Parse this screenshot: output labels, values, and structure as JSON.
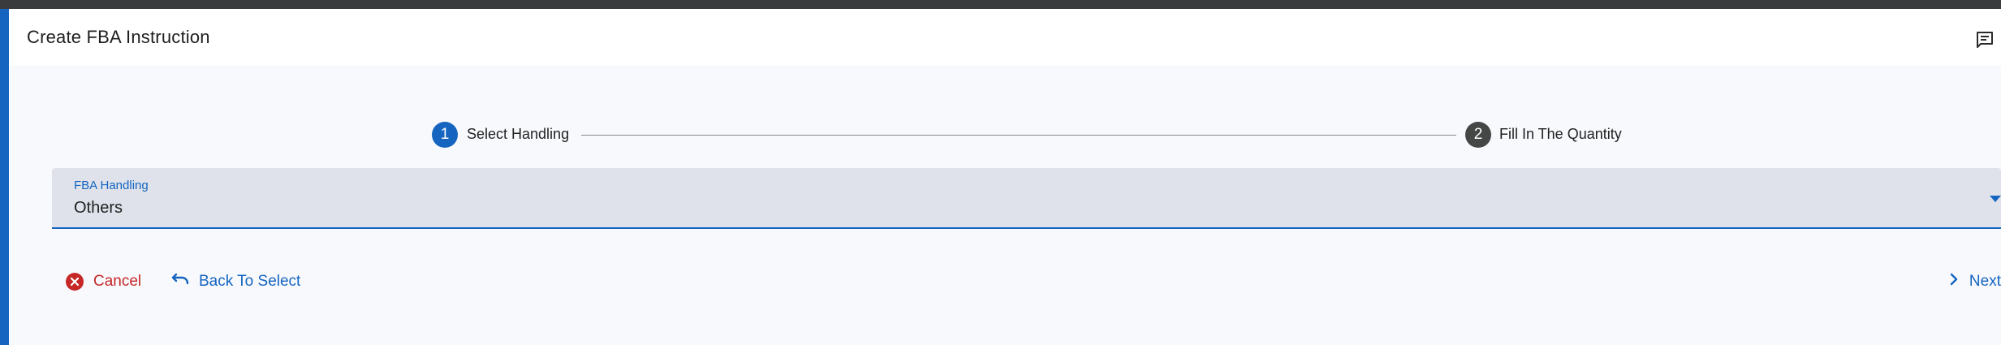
{
  "dialog": {
    "title": "Create FBA Instruction",
    "header_icon": "comment-icon"
  },
  "stepper": {
    "steps": [
      {
        "number": "1",
        "label": "Select Handling",
        "state": "active"
      },
      {
        "number": "2",
        "label": "Fill In The Quantity",
        "state": "inactive"
      }
    ]
  },
  "form": {
    "fba_handling": {
      "label": "FBA Handling",
      "value": "Others"
    }
  },
  "actions": {
    "cancel_label": "Cancel",
    "back_label": "Back To Select",
    "next_label": "Next"
  },
  "colors": {
    "primary": "#1565c0",
    "danger": "#c62828",
    "step_inactive": "#444746",
    "field_background": "#dfe2ea"
  }
}
